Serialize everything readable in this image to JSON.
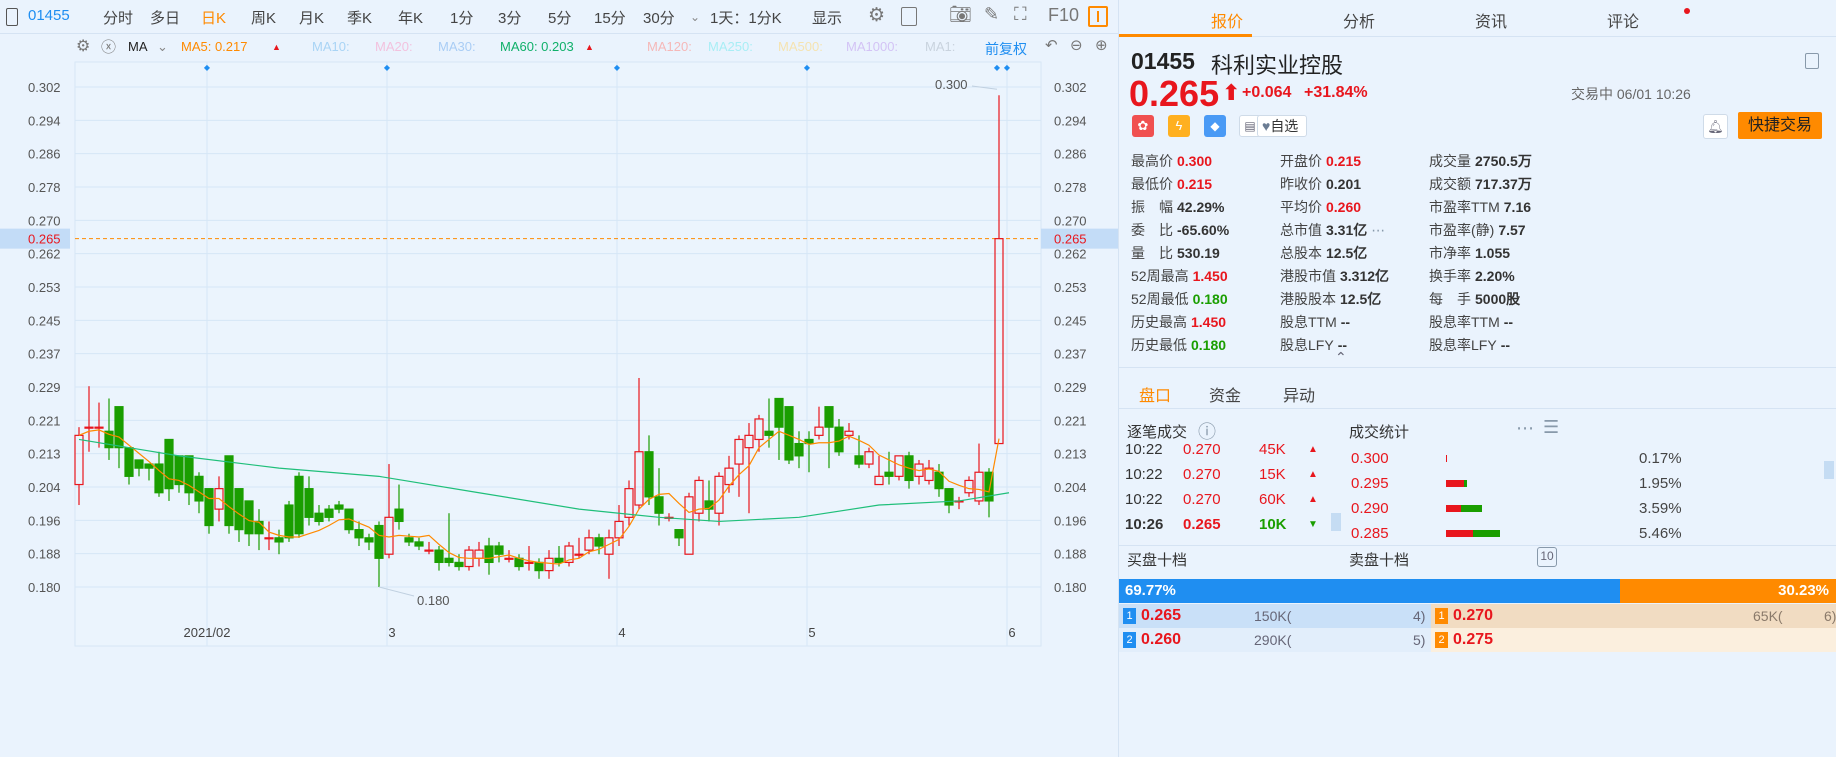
{
  "toolbar": {
    "code": "01455",
    "items": [
      "分时",
      "多日",
      "日K",
      "周K",
      "月K",
      "季K",
      "年K",
      "1分",
      "3分",
      "5分",
      "15分",
      "30分"
    ],
    "active": "日K",
    "period": "1天：1分K",
    "display": "显示",
    "f10": "F10"
  },
  "ma_row": {
    "ma": "MA",
    "ma5": "MA5: 0.217",
    "ma10": "MA10:",
    "ma20": "MA20:",
    "ma30": "MA30:",
    "ma60": "MA60: 0.203",
    "ma120": "MA120:",
    "ma250": "MA250:",
    "ma500": "MA500:",
    "ma1000": "MA1000:",
    "ma1": "MA1:",
    "adjust": "前复权"
  },
  "colors": {
    "up": "#e8161d",
    "down": "#1a9e00",
    "ma5": "#ff8a00",
    "ma60": "#1fbf7a",
    "accent": "#ff8a00",
    "blue": "#1f8ef1"
  },
  "chart_data": {
    "type": "candlestick",
    "y_ticks": [
      "0.302",
      "0.294",
      "0.286",
      "0.278",
      "0.270",
      "0.262",
      "0.253",
      "0.245",
      "0.237",
      "0.229",
      "0.221",
      "0.213",
      "0.204",
      "0.196",
      "0.188",
      "0.180"
    ],
    "ylim": [
      0.18,
      0.302
    ],
    "current": "0.265",
    "x_labels": [
      {
        "label": "2021/02",
        "index": 13
      },
      {
        "label": "3",
        "index": 31
      },
      {
        "label": "4",
        "index": 54
      },
      {
        "label": "5",
        "index": 73
      },
      {
        "label": "6",
        "index": 93
      }
    ],
    "annotations": {
      "high": "0.300",
      "low": "0.180"
    },
    "ohlc": [
      [
        0.205,
        0.217,
        0.219,
        0.2
      ],
      [
        0.219,
        0.219,
        0.229,
        0.213
      ],
      [
        0.219,
        0.219,
        0.225,
        0.214
      ],
      [
        0.218,
        0.214,
        0.226,
        0.211
      ],
      [
        0.224,
        0.214,
        0.224,
        0.209
      ],
      [
        0.214,
        0.207,
        0.214,
        0.205
      ],
      [
        0.211,
        0.209,
        0.211,
        0.207
      ],
      [
        0.21,
        0.209,
        0.21,
        0.206
      ],
      [
        0.21,
        0.203,
        0.213,
        0.202
      ],
      [
        0.216,
        0.204,
        0.216,
        0.201
      ],
      [
        0.212,
        0.205,
        0.212,
        0.203
      ],
      [
        0.212,
        0.203,
        0.212,
        0.2
      ],
      [
        0.207,
        0.201,
        0.208,
        0.198
      ],
      [
        0.204,
        0.195,
        0.204,
        0.193
      ],
      [
        0.199,
        0.204,
        0.207,
        0.196
      ],
      [
        0.212,
        0.195,
        0.212,
        0.193
      ],
      [
        0.204,
        0.194,
        0.204,
        0.191
      ],
      [
        0.201,
        0.193,
        0.201,
        0.19
      ],
      [
        0.196,
        0.193,
        0.199,
        0.189
      ],
      [
        0.192,
        0.192,
        0.196,
        0.189
      ],
      [
        0.192,
        0.191,
        0.194,
        0.188
      ],
      [
        0.2,
        0.192,
        0.201,
        0.191
      ],
      [
        0.207,
        0.193,
        0.208,
        0.192
      ],
      [
        0.204,
        0.197,
        0.207,
        0.195
      ],
      [
        0.198,
        0.196,
        0.2,
        0.195
      ],
      [
        0.199,
        0.197,
        0.2,
        0.196
      ],
      [
        0.2,
        0.199,
        0.201,
        0.198
      ],
      [
        0.199,
        0.194,
        0.199,
        0.193
      ],
      [
        0.194,
        0.192,
        0.196,
        0.19
      ],
      [
        0.192,
        0.191,
        0.193,
        0.189
      ],
      [
        0.195,
        0.187,
        0.196,
        0.18
      ],
      [
        0.188,
        0.197,
        0.21,
        0.187
      ],
      [
        0.199,
        0.196,
        0.205,
        0.194
      ],
      [
        0.192,
        0.191,
        0.193,
        0.19
      ],
      [
        0.191,
        0.19,
        0.192,
        0.189
      ],
      [
        0.189,
        0.189,
        0.191,
        0.188
      ],
      [
        0.189,
        0.186,
        0.19,
        0.184
      ],
      [
        0.187,
        0.186,
        0.198,
        0.185
      ],
      [
        0.186,
        0.185,
        0.188,
        0.184
      ],
      [
        0.185,
        0.189,
        0.19,
        0.184
      ],
      [
        0.187,
        0.189,
        0.191,
        0.185
      ],
      [
        0.19,
        0.186,
        0.192,
        0.183
      ],
      [
        0.19,
        0.188,
        0.191,
        0.186
      ],
      [
        0.187,
        0.187,
        0.189,
        0.186
      ],
      [
        0.187,
        0.185,
        0.188,
        0.184
      ],
      [
        0.186,
        0.186,
        0.19,
        0.184
      ],
      [
        0.186,
        0.184,
        0.187,
        0.182
      ],
      [
        0.184,
        0.187,
        0.189,
        0.182
      ],
      [
        0.187,
        0.186,
        0.19,
        0.185
      ],
      [
        0.186,
        0.19,
        0.191,
        0.185
      ],
      [
        0.188,
        0.188,
        0.192,
        0.187
      ],
      [
        0.189,
        0.192,
        0.194,
        0.188
      ],
      [
        0.192,
        0.19,
        0.193,
        0.188
      ],
      [
        0.188,
        0.192,
        0.194,
        0.182
      ],
      [
        0.192,
        0.196,
        0.2,
        0.19
      ],
      [
        0.197,
        0.204,
        0.206,
        0.195
      ],
      [
        0.2,
        0.213,
        0.231,
        0.199
      ],
      [
        0.213,
        0.202,
        0.217,
        0.2
      ],
      [
        0.202,
        0.198,
        0.209,
        0.195
      ],
      [
        0.197,
        0.197,
        0.198,
        0.196
      ],
      [
        0.194,
        0.192,
        0.194,
        0.19
      ],
      [
        0.188,
        0.202,
        0.203,
        0.188
      ],
      [
        0.198,
        0.206,
        0.207,
        0.196
      ],
      [
        0.201,
        0.199,
        0.206,
        0.196
      ],
      [
        0.198,
        0.207,
        0.208,
        0.195
      ],
      [
        0.205,
        0.209,
        0.212,
        0.203
      ],
      [
        0.21,
        0.216,
        0.217,
        0.202
      ],
      [
        0.214,
        0.217,
        0.22,
        0.198
      ],
      [
        0.216,
        0.221,
        0.222,
        0.213
      ],
      [
        0.218,
        0.217,
        0.226,
        0.214
      ],
      [
        0.226,
        0.219,
        0.226,
        0.211
      ],
      [
        0.224,
        0.211,
        0.224,
        0.21
      ],
      [
        0.215,
        0.212,
        0.218,
        0.209
      ],
      [
        0.216,
        0.215,
        0.218,
        0.208
      ],
      [
        0.217,
        0.219,
        0.224,
        0.216
      ],
      [
        0.224,
        0.219,
        0.224,
        0.209
      ],
      [
        0.219,
        0.213,
        0.221,
        0.212
      ],
      [
        0.217,
        0.218,
        0.22,
        0.216
      ],
      [
        0.212,
        0.21,
        0.217,
        0.209
      ],
      [
        0.21,
        0.213,
        0.214,
        0.209
      ],
      [
        0.205,
        0.207,
        0.212,
        0.205
      ],
      [
        0.208,
        0.207,
        0.213,
        0.205
      ],
      [
        0.207,
        0.212,
        0.212,
        0.206
      ],
      [
        0.212,
        0.206,
        0.213,
        0.204
      ],
      [
        0.207,
        0.21,
        0.211,
        0.205
      ],
      [
        0.206,
        0.209,
        0.211,
        0.205
      ],
      [
        0.208,
        0.204,
        0.21,
        0.202
      ],
      [
        0.204,
        0.2,
        0.204,
        0.198
      ],
      [
        0.201,
        0.201,
        0.202,
        0.199
      ],
      [
        0.203,
        0.206,
        0.207,
        0.202
      ],
      [
        0.201,
        0.208,
        0.215,
        0.2
      ],
      [
        0.208,
        0.201,
        0.209,
        0.197
      ],
      [
        0.215,
        0.265,
        0.3,
        0.215
      ]
    ],
    "ma60": [
      [
        0,
        0.216
      ],
      [
        10,
        0.212
      ],
      [
        20,
        0.209
      ],
      [
        30,
        0.207
      ],
      [
        40,
        0.203
      ],
      [
        50,
        0.199
      ],
      [
        58,
        0.197
      ],
      [
        64,
        0.196
      ],
      [
        72,
        0.197
      ],
      [
        80,
        0.2
      ],
      [
        88,
        0.201
      ],
      [
        93,
        0.203
      ]
    ]
  },
  "right": {
    "tabs": [
      "报价",
      "分析",
      "资讯",
      "评论"
    ],
    "code": "01455",
    "name": "科利实业控股",
    "price": "0.265",
    "arrow": "⬆",
    "change": "+0.064",
    "pct": "+31.84%",
    "status": "交易中 06/01 10:26",
    "watch": "自选",
    "trade": "快捷交易",
    "stats": [
      [
        {
          "k": "最高价",
          "v": "0.300",
          "c": "red"
        },
        {
          "k": "开盘价",
          "v": "0.215",
          "c": "red"
        },
        {
          "k": "成交量",
          "v": "2750.5万",
          "c": ""
        }
      ],
      [
        {
          "k": "最低价",
          "v": "0.215",
          "c": "red"
        },
        {
          "k": "昨收价",
          "v": "0.201",
          "c": ""
        },
        {
          "k": "成交额",
          "v": "717.37万",
          "c": ""
        }
      ],
      [
        {
          "k": "振　幅",
          "v": "42.29%",
          "c": ""
        },
        {
          "k": "平均价",
          "v": "0.260",
          "c": "red"
        },
        {
          "k": "市盈率TTM",
          "v": "7.16",
          "c": ""
        }
      ],
      [
        {
          "k": "委　比",
          "v": "-65.60%",
          "c": ""
        },
        {
          "k": "总市值",
          "v": "3.31亿",
          "c": ""
        },
        {
          "k": "市盈率(静)",
          "v": "7.57",
          "c": ""
        }
      ],
      [
        {
          "k": "量　比",
          "v": "530.19",
          "c": ""
        },
        {
          "k": "总股本",
          "v": "12.5亿",
          "c": ""
        },
        {
          "k": "市净率",
          "v": "1.055",
          "c": ""
        }
      ],
      [
        {
          "k": "52周最高",
          "v": "1.450",
          "c": "red"
        },
        {
          "k": "港股市值",
          "v": "3.312亿",
          "c": ""
        },
        {
          "k": "换手率",
          "v": "2.20%",
          "c": ""
        }
      ],
      [
        {
          "k": "52周最低",
          "v": "0.180",
          "c": "green"
        },
        {
          "k": "港股股本",
          "v": "12.5亿",
          "c": ""
        },
        {
          "k": "每　手",
          "v": "5000股",
          "c": ""
        }
      ],
      [
        {
          "k": "历史最高",
          "v": "1.450",
          "c": "red"
        },
        {
          "k": "股息TTM",
          "v": "--",
          "c": ""
        },
        {
          "k": "股息率TTM",
          "v": "--",
          "c": ""
        }
      ],
      [
        {
          "k": "历史最低",
          "v": "0.180",
          "c": "green"
        },
        {
          "k": "股息LFY",
          "v": "--",
          "c": ""
        },
        {
          "k": "股息率LFY",
          "v": "--",
          "c": ""
        }
      ]
    ],
    "subtabs": [
      "盘口",
      "资金",
      "异动"
    ],
    "ticks_title": "逐笔成交",
    "stats_title": "成交统计",
    "ticks": [
      {
        "t": "10:22",
        "p": "0.270",
        "v": "45K",
        "d": "up"
      },
      {
        "t": "10:22",
        "p": "0.270",
        "v": "15K",
        "d": "up"
      },
      {
        "t": "10:22",
        "p": "0.270",
        "v": "60K",
        "d": "up"
      },
      {
        "t": "10:26",
        "p": "0.265",
        "v": "10K",
        "d": "down"
      }
    ],
    "vol_stats": [
      {
        "p": "0.300",
        "pct": "0.17%",
        "buy": 0.2,
        "sell": 0
      },
      {
        "p": "0.295",
        "pct": "1.95%",
        "buy": 3,
        "sell": 0.5
      },
      {
        "p": "0.290",
        "pct": "3.59%",
        "buy": 2.5,
        "sell": 3.5
      },
      {
        "p": "0.285",
        "pct": "5.46%",
        "buy": 4.5,
        "sell": 4.5
      }
    ],
    "bid_title": "买盘十档",
    "ask_title": "卖盘十档",
    "depth_btn": "10",
    "bid_pct": "69.77%",
    "ask_pct": "30.23%",
    "bid_ratio": 69.77,
    "bids": [
      {
        "n": "1",
        "p": "0.265",
        "v": "150K(",
        "c": "4)"
      },
      {
        "n": "2",
        "p": "0.260",
        "v": "290K(",
        "c": "5)"
      }
    ],
    "asks": [
      {
        "n": "1",
        "p": "0.270",
        "v": "65K(",
        "c": "6)"
      },
      {
        "n": "2",
        "p": "0.275",
        "v": "",
        "c": ""
      }
    ]
  }
}
